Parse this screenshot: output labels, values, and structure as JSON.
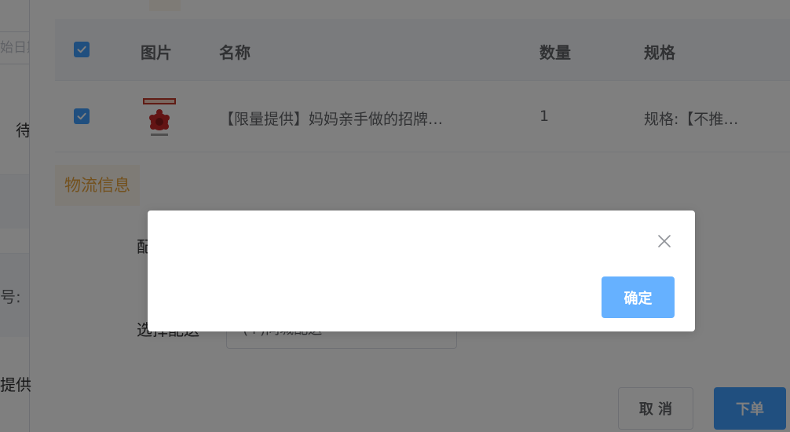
{
  "left_panel": {
    "date_placeholder": "始日期",
    "tab_label": "待",
    "field_label": "号:",
    "row_text": "提供"
  },
  "order_table": {
    "headers": [
      "图片",
      "名称",
      "数量",
      "规格"
    ],
    "rows": [
      {
        "checked": true,
        "thumbnail_icon": "product-thumbnail",
        "name": "【限量提供】妈妈亲手做的招牌…",
        "quantity": "1",
        "spec": "规格:【不推…"
      }
    ],
    "header_checked": true
  },
  "logistics": {
    "section_title": "物流信息",
    "delivery_label": "配",
    "select_label": "选择配送",
    "select_value": "(+)同城配送"
  },
  "footer": {
    "cancel_label": "取 消",
    "order_label": "下单"
  },
  "modal": {
    "close_icon": "close-icon",
    "confirm_label": "确定"
  },
  "colors": {
    "primary": "#409eff",
    "primary_light": "#66b1ff",
    "warning": "#e6a23c",
    "warning_bg": "#fdf6ec",
    "mask": "rgba(0,0,0,0.5)"
  }
}
